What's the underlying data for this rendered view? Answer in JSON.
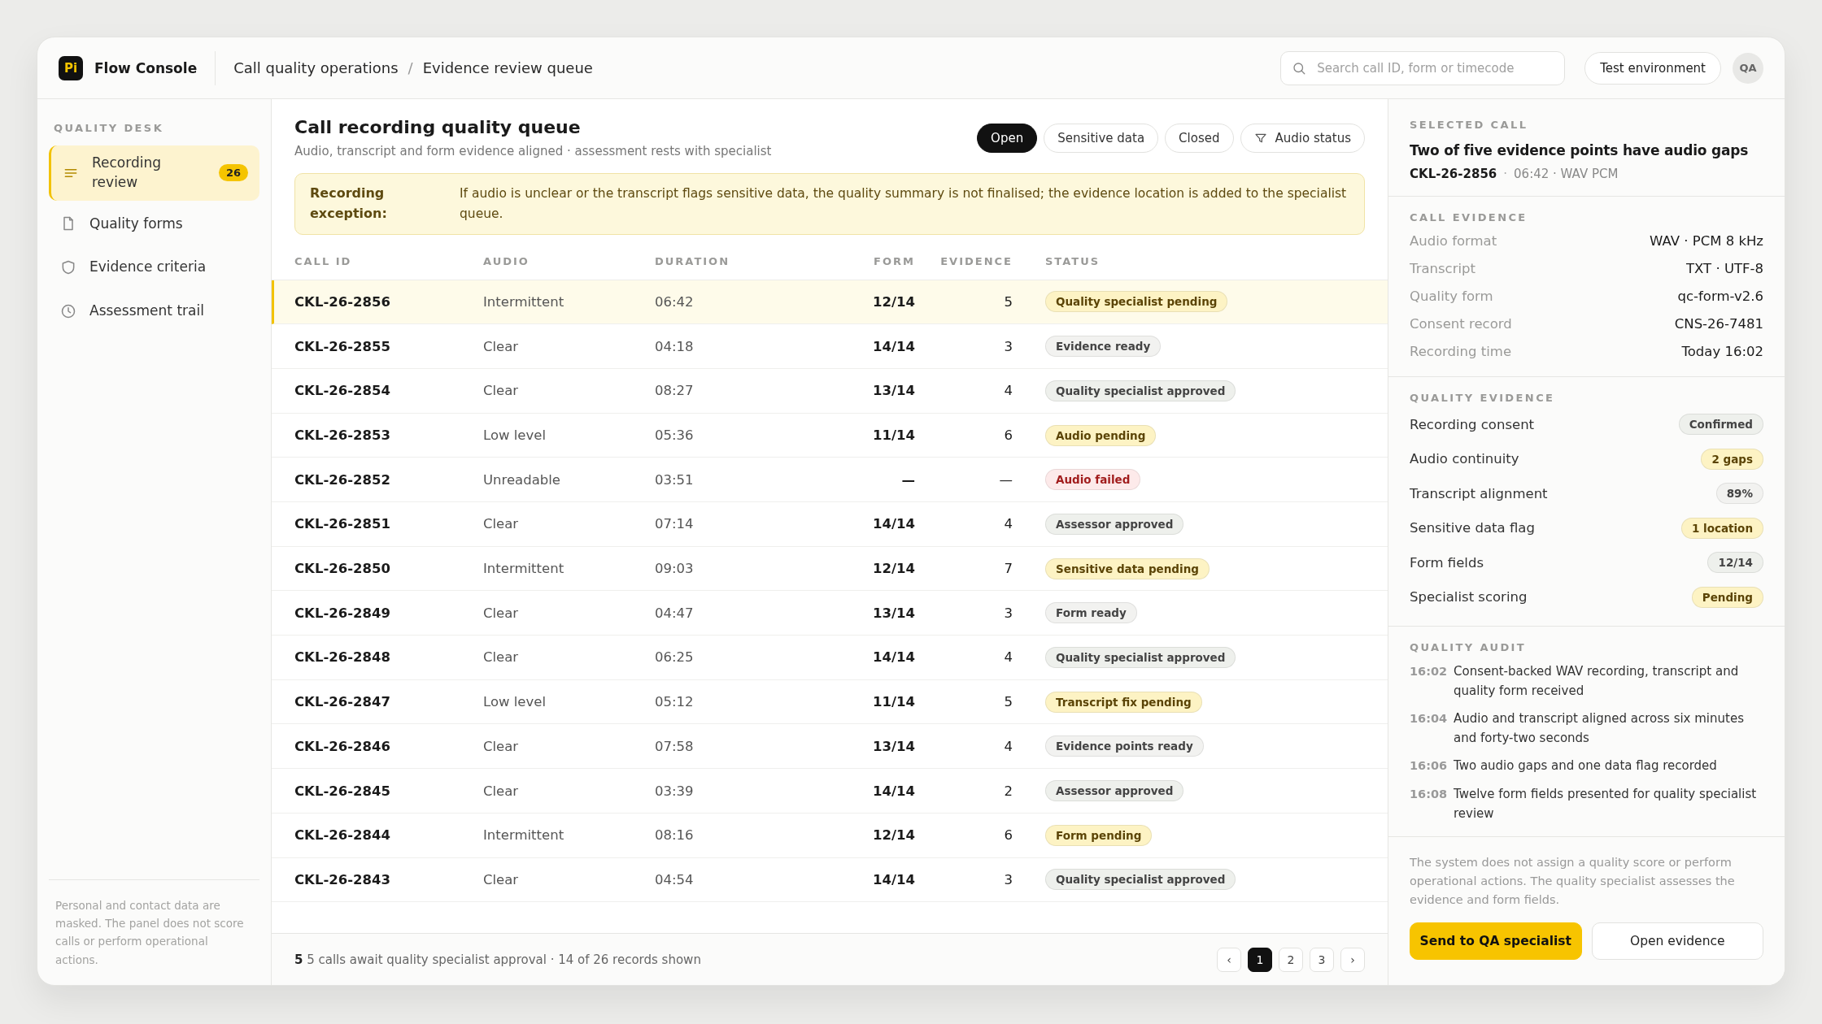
{
  "app": {
    "logo": "Pi",
    "name": "Flow Console"
  },
  "breadcrumb": {
    "items": [
      "Call quality operations",
      "Evidence review queue"
    ],
    "separator": "/"
  },
  "search": {
    "placeholder": "Search call ID, form or timecode"
  },
  "environment": "Test environment",
  "avatar": "QA",
  "sidebar": {
    "heading": "QUALITY DESK",
    "items": [
      {
        "label": "Recording review",
        "count": "26",
        "selected": true
      },
      {
        "label": "Quality forms",
        "selected": false
      },
      {
        "label": "Evidence criteria",
        "selected": false
      },
      {
        "label": "Assessment trail",
        "selected": false
      }
    ],
    "note": "Personal and contact data are masked. The panel does not score calls or perform operational actions."
  },
  "queue": {
    "title": "Call recording quality queue",
    "subtitle": "Audio, transcript and form evidence aligned · assessment rests with specialist",
    "filters": [
      {
        "label": "Open",
        "kind": "chip",
        "selected": true
      },
      {
        "label": "Sensitive data",
        "kind": "chip",
        "selected": false
      },
      {
        "label": "Closed",
        "kind": "chip",
        "selected": false
      },
      {
        "label": "Audio status",
        "kind": "dropdown",
        "selected": false
      }
    ],
    "banner": {
      "label": "Recording exception:",
      "text": "If audio is unclear or the transcript flags sensitive data, the quality summary is not finalised; the evidence location is added to the specialist queue."
    }
  },
  "table": {
    "columns": [
      "CALL ID",
      "AUDIO",
      "DURATION",
      "FORM",
      "EVIDENCE",
      "STATUS"
    ],
    "rows": [
      {
        "id": "CKL-26-2856",
        "audio": "Intermittent",
        "duration": "06:42",
        "form": "12/14",
        "evidence": "5",
        "status": "Quality specialist pending",
        "color": "#fdf3c4",
        "selected": true
      },
      {
        "id": "CKL-26-2855",
        "audio": "Clear",
        "duration": "04:18",
        "form": "14/14",
        "evidence": "3",
        "status": "Evidence ready",
        "color": "#f2f2f0",
        "selected": false
      },
      {
        "id": "CKL-26-2854",
        "audio": "Clear",
        "duration": "08:27",
        "form": "13/14",
        "evidence": "4",
        "status": "Quality specialist approved",
        "color": "#eef0ec",
        "selected": false
      },
      {
        "id": "CKL-26-2853",
        "audio": "Low level",
        "duration": "05:36",
        "form": "11/14",
        "evidence": "6",
        "status": "Audio pending",
        "color": "#fdf3c4",
        "selected": false
      },
      {
        "id": "CKL-26-2852",
        "audio": "Unreadable",
        "duration": "03:51",
        "form": "—",
        "evidence": "—",
        "status": "Audio failed",
        "color": "#fdeaea",
        "selected": false
      },
      {
        "id": "CKL-26-2851",
        "audio": "Clear",
        "duration": "07:14",
        "form": "14/14",
        "evidence": "4",
        "status": "Assessor approved",
        "color": "#eef0ec",
        "selected": false
      },
      {
        "id": "CKL-26-2850",
        "audio": "Intermittent",
        "duration": "09:03",
        "form": "12/14",
        "evidence": "7",
        "status": "Sensitive data pending",
        "color": "#fdf3c4",
        "selected": false
      },
      {
        "id": "CKL-26-2849",
        "audio": "Clear",
        "duration": "04:47",
        "form": "13/14",
        "evidence": "3",
        "status": "Form ready",
        "color": "#f2f2f0",
        "selected": false
      },
      {
        "id": "CKL-26-2848",
        "audio": "Clear",
        "duration": "06:25",
        "form": "14/14",
        "evidence": "4",
        "status": "Quality specialist approved",
        "color": "#eef0ec",
        "selected": false
      },
      {
        "id": "CKL-26-2847",
        "audio": "Low level",
        "duration": "05:12",
        "form": "11/14",
        "evidence": "5",
        "status": "Transcript fix pending",
        "color": "#fdf3c4",
        "selected": false
      },
      {
        "id": "CKL-26-2846",
        "audio": "Clear",
        "duration": "07:58",
        "form": "13/14",
        "evidence": "4",
        "status": "Evidence points ready",
        "color": "#f2f2f0",
        "selected": false
      },
      {
        "id": "CKL-26-2845",
        "audio": "Clear",
        "duration": "03:39",
        "form": "14/14",
        "evidence": "2",
        "status": "Assessor approved",
        "color": "#eef0ec",
        "selected": false
      },
      {
        "id": "CKL-26-2844",
        "audio": "Intermittent",
        "duration": "08:16",
        "form": "12/14",
        "evidence": "6",
        "status": "Form pending",
        "color": "#fdf3c4",
        "selected": false
      },
      {
        "id": "CKL-26-2843",
        "audio": "Clear",
        "duration": "04:54",
        "form": "14/14",
        "evidence": "3",
        "status": "Quality specialist approved",
        "color": "#eef0ec",
        "selected": false
      }
    ],
    "footer": "**5** 5 calls await quality specialist approval · 14 of 26 records shown",
    "pagination": {
      "prev": "‹",
      "next": "›",
      "pages": [
        {
          "label": "1",
          "selected": true
        },
        {
          "label": "2",
          "selected": false
        },
        {
          "label": "3",
          "selected": false
        }
      ]
    }
  },
  "detail": {
    "heading": "SELECTED CALL",
    "title": "Two of five evidence points have audio gaps",
    "call_id": "CKL-26-2856",
    "meta_separator": "·",
    "meta": "06:42 · WAV PCM",
    "call_evidence": {
      "heading": "CALL EVIDENCE",
      "rows": [
        {
          "label": "Audio format",
          "value": "WAV · PCM 8 kHz"
        },
        {
          "label": "Transcript",
          "value": "TXT · UTF-8"
        },
        {
          "label": "Quality form",
          "value": "qc-form-v2.6"
        },
        {
          "label": "Consent record",
          "value": "CNS-26-7481"
        },
        {
          "label": "Recording time",
          "value": "Today 16:02"
        }
      ]
    },
    "quality_evidence": {
      "heading": "QUALITY EVIDENCE",
      "rows": [
        {
          "label": "Recording consent",
          "value": "Confirmed",
          "color": "#eef0ec"
        },
        {
          "label": "Audio continuity",
          "value": "2 gaps",
          "color": "#fdf3c4"
        },
        {
          "label": "Transcript alignment",
          "value": "89%",
          "color": "#f2f2f0"
        },
        {
          "label": "Sensitive data flag",
          "value": "1 location",
          "color": "#fdf3c4"
        },
        {
          "label": "Form fields",
          "value": "12/14",
          "color": "#eef0ec"
        },
        {
          "label": "Specialist scoring",
          "value": "Pending",
          "color": "#fdf3c4"
        }
      ]
    },
    "audit": {
      "heading": "QUALITY AUDIT",
      "entries": [
        {
          "time": "16:02",
          "text": "Consent-backed WAV recording, transcript and quality form received"
        },
        {
          "time": "16:04",
          "text": "Audio and transcript aligned across six minutes and forty-two seconds"
        },
        {
          "time": "16:06",
          "text": "Two audio gaps and one data flag recorded"
        },
        {
          "time": "16:08",
          "text": "Twelve form fields presented for quality specialist review"
        }
      ]
    },
    "note": "The system does not assign a quality score or perform operational actions. The quality specialist assesses the evidence and form fields.",
    "actions": [
      {
        "label": "Send to QA specialist",
        "kind": "primary"
      },
      {
        "label": "Open evidence",
        "kind": "secondary"
      }
    ]
  }
}
